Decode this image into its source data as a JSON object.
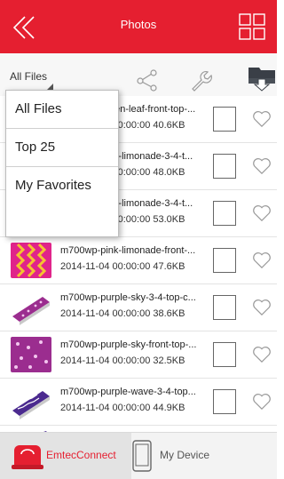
{
  "header": {
    "title": "Photos"
  },
  "toolbar": {
    "filter_label": "All Files"
  },
  "files": [
    {
      "name": "m700wp-green-leaf-front-top-...",
      "date": "2014-11-04 00:00:00",
      "size": "40.6KB"
    },
    {
      "name": "m700wp-pink-limonade-3-4-t...",
      "date": "2014-11-04 00:00:00",
      "size": "48.0KB"
    },
    {
      "name": "m700wp-pink-limonade-3-4-t...",
      "date": "2014-11-04 00:00:00",
      "size": "53.0KB"
    },
    {
      "name": "m700wp-pink-limonade-front-...",
      "date": "2014-11-04 00:00:00",
      "size": "47.6KB"
    },
    {
      "name": "m700wp-purple-sky-3-4-top-c...",
      "date": "2014-11-04 00:00:00",
      "size": "38.6KB"
    },
    {
      "name": "m700wp-purple-sky-front-top-...",
      "date": "2014-11-04 00:00:00",
      "size": "32.5KB"
    },
    {
      "name": "m700wp-purple-wave-3-4-top...",
      "date": "2014-11-04 00:00:00",
      "size": "44.9KB"
    }
  ],
  "dropdown": {
    "items": [
      "All Files",
      "Top 25",
      "My Favorites"
    ]
  },
  "bottom_nav": {
    "tab1": "EmtecConnect",
    "tab2": "My Device"
  },
  "colors": {
    "accent": "#e51f30",
    "checkbox_border": "#666666",
    "heart": "#999999"
  },
  "icons": {
    "back": "double-chevron-left-icon",
    "grid": "grid-view-icon",
    "share": "share-icon",
    "settings": "wrench-icon",
    "download": "download-icon",
    "favorite": "heart-icon",
    "emtec": "emtec-connect-icon",
    "device": "phone-device-icon"
  }
}
